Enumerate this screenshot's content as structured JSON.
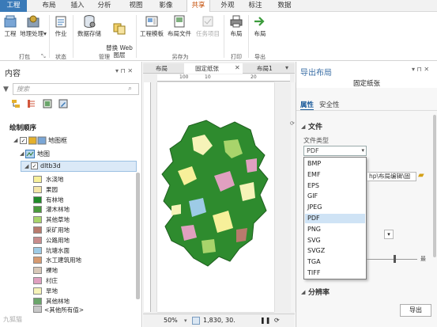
{
  "ribbon_tabs": [
    "工程",
    "布局",
    "插入",
    "分析",
    "视图",
    "影像",
    "共享",
    "外观",
    "标注",
    "数据"
  ],
  "ribbon": {
    "buttons": {
      "project": "工程",
      "geoprocessing": "地理处理",
      "job": "作业",
      "data_store": "数据存储",
      "web_layer": "替换 Web\n图层",
      "layout_template": "工程模板",
      "layout_file": "布局文件",
      "task_item": "任务项目",
      "print_layout": "布局",
      "export_layout": "布局"
    },
    "groups": {
      "package": "打包",
      "status": "状态",
      "manage": "管理",
      "save_as": "另存为",
      "print": "打印",
      "export": "导出"
    }
  },
  "contents": {
    "title": "内容",
    "search_placeholder": "搜索",
    "section": "绘制顺序",
    "map_frame": "地图框",
    "map": "地图",
    "layer": "dltb3d",
    "legend": [
      {
        "label": "水浇地",
        "color": "#f7f09a"
      },
      {
        "label": "果园",
        "color": "#f4e6a8"
      },
      {
        "label": "有林地",
        "color": "#1f8a28"
      },
      {
        "label": "灌木林地",
        "color": "#4a9a3c"
      },
      {
        "label": "其他草地",
        "color": "#a8d46b"
      },
      {
        "label": "采矿用地",
        "color": "#b97a6d"
      },
      {
        "label": "公路用地",
        "color": "#c88c8c"
      },
      {
        "label": "坑塘水面",
        "color": "#9dcbe6"
      },
      {
        "label": "水工建筑用地",
        "color": "#d69a70"
      },
      {
        "label": "裸地",
        "color": "#d8c8b8"
      },
      {
        "label": "村庄",
        "color": "#e0a0c0"
      },
      {
        "label": "旱地",
        "color": "#f6f3b8"
      },
      {
        "label": "其他林地",
        "color": "#6aa56a"
      }
    ],
    "other_values": "<其他所有值>"
  },
  "map_tabs": [
    "布局",
    "固定纸张",
    "布局1"
  ],
  "hruler_labels": [
    "100",
    "10",
    "20"
  ],
  "status": {
    "zoom": "50%",
    "coords": "1,830, 30."
  },
  "export_pane": {
    "title": "导出布局",
    "subtitle": "固定纸张",
    "tabs": [
      "属性",
      "安全性"
    ],
    "file_section": "文件",
    "file_type_label": "文件类型",
    "file_type_value": "PDF",
    "options": [
      "BMP",
      "EMF",
      "EPS",
      "GIF",
      "JPEG",
      "PDF",
      "PNG",
      "SVG",
      "SVGZ",
      "TGA",
      "TIFF"
    ],
    "selected_option": "PDF",
    "path": "hp\\布局编辑\\固",
    "quality_end": "最",
    "resolution_section": "分辨率",
    "export_button": "导出"
  },
  "watermark": "九狐猫"
}
